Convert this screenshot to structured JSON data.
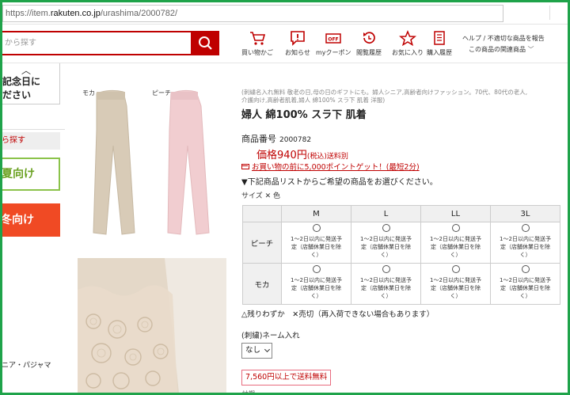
{
  "browser": {
    "url_prefix": "https://item.",
    "url_domain": "rakuten.co.jp",
    "url_path": "/urashima/2000782/"
  },
  "header": {
    "search_placeholder": "から探す",
    "icons": [
      {
        "label": "買い物かご",
        "icon": "cart-icon"
      },
      {
        "label": "お知らせ",
        "icon": "notice-icon"
      },
      {
        "label": "myクーポン",
        "icon": "coupon-icon"
      },
      {
        "label": "閲覧履歴",
        "icon": "history-icon"
      },
      {
        "label": "お気に入り",
        "icon": "star-icon"
      },
      {
        "label": "購入履歴",
        "icon": "purchase-history-icon"
      }
    ],
    "help_line1": "ヘルプ / 不適切な商品を報告",
    "help_line2": "この商品の関連商品"
  },
  "sidebar": {
    "box1_line1": "記念日に",
    "box1_line2": "ださい",
    "box2": "ら探す",
    "box3": "夏向け",
    "box4": "冬向け",
    "bottom": "ニア・パジャマ"
  },
  "images": {
    "label_left": "モカ",
    "label_right": "ピーチ"
  },
  "product": {
    "tags_line1": "(刺繍名入れ無料 敬老の日,母の日のギフトにも。婦人シニア,高齢者向けファッション。70代、80代の老人,",
    "tags_line2": "介護向け,高齢者肌着,婦人 綿100% スラ下 肌着 洋服)",
    "title": "婦人 綿100% スラ下 肌着",
    "number_label": "商品番号",
    "number_value": "2000782",
    "price_main": "価格940円",
    "price_tax": "(税込)",
    "price_ship": "送料別",
    "points_text": "お買い物の前に5,000ポイントゲット！(最短2分)",
    "notice": "▼下記商品リストからご希望の商品をお選びください。",
    "size_color": "サイズ ✕ 色"
  },
  "variant_table": {
    "sizes": [
      "M",
      "L",
      "LL",
      "3L"
    ],
    "colors": [
      "ピーチ",
      "モカ"
    ],
    "cell_line1": "1〜2日以内に発送予",
    "cell_line2": "定（店舗休業日を除",
    "cell_line3": "く）"
  },
  "legend_text": "△残りわずか　✕売切（再入荷できない場合もあります）",
  "embroidery": {
    "label": "(刺繍)ネーム入れ",
    "selected": "なし"
  },
  "ship_badge": "7,560円以上で送料無料",
  "cutoff_text": "納期"
}
